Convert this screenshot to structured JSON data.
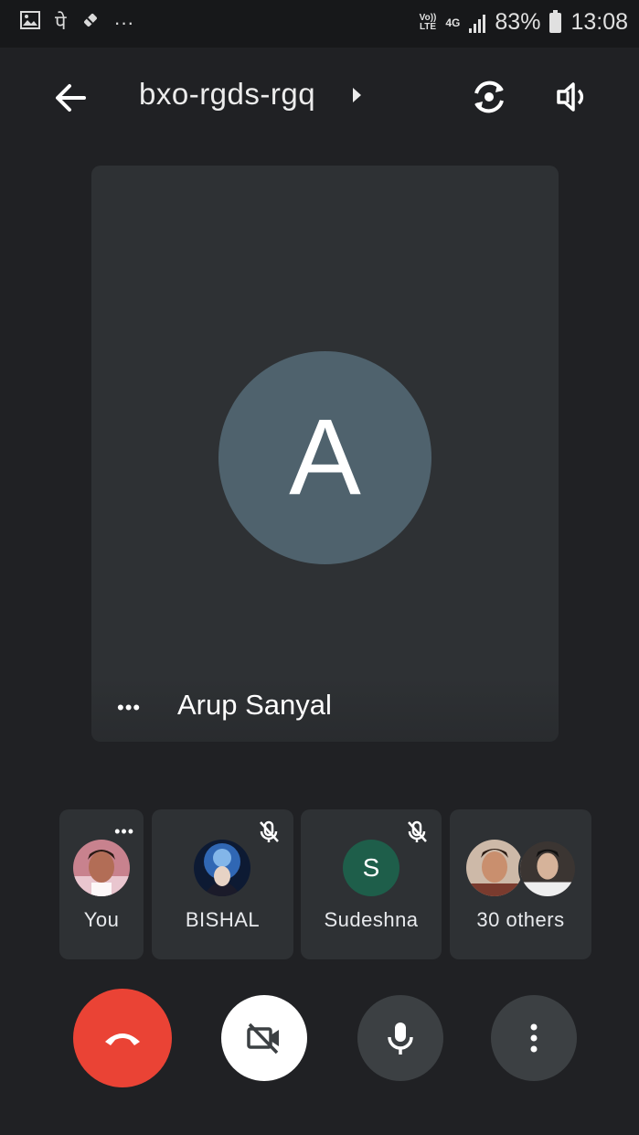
{
  "status_bar": {
    "left_icons": [
      "image-icon",
      "devanagari-icon",
      "battery-saver-icon",
      "more-dots-icon"
    ],
    "devanagari_glyph": "पे",
    "more_glyph": "···",
    "volte_line1": "Vo))",
    "volte_line2": "LTE",
    "network": "4G",
    "battery": "83%",
    "time": "13:08"
  },
  "appbar": {
    "title": "bxo-rgds-rgq",
    "icons": [
      "back-arrow-icon",
      "title-arrow-icon",
      "switch-camera-icon",
      "speaker-icon"
    ]
  },
  "main_tile": {
    "avatar_letter": "A",
    "avatar_color": "#4f626d",
    "more_label": "•••",
    "participant_name": "Arup Sanyal"
  },
  "participants": [
    {
      "label": "You",
      "muted": false,
      "more_label": "•••"
    },
    {
      "label": "BISHAL",
      "muted": true
    },
    {
      "label": "Sudeshna",
      "muted": true,
      "avatar_letter": "S",
      "avatar_color": "#1e5e4a"
    },
    {
      "label": "30 others",
      "muted": false
    }
  ],
  "controls": [
    {
      "name": "end-call",
      "color": "#ea4335"
    },
    {
      "name": "camera-off"
    },
    {
      "name": "microphone"
    },
    {
      "name": "more-options"
    }
  ]
}
